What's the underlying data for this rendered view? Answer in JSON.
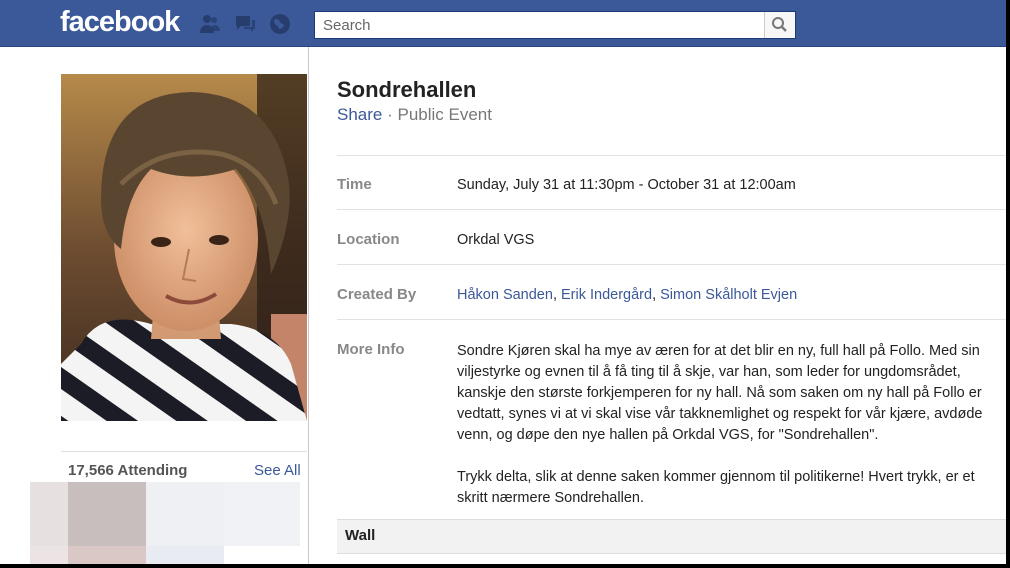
{
  "header": {
    "logo": "facebook",
    "search_placeholder": "Search",
    "colors": {
      "bar": "#3b5998",
      "link": "#3b5998"
    },
    "icons": [
      "friend-requests-icon",
      "messages-icon",
      "notifications-icon",
      "magnifier-icon"
    ]
  },
  "sidebar": {
    "attending": "17,566 Attending",
    "see_all": "See All"
  },
  "event": {
    "title": "Sondrehallen",
    "share": "Share",
    "separator": " · ",
    "type": "Public Event",
    "time_label": "Time",
    "time_value": "Sunday, July 31 at 11:30pm - October 31 at 12:00am",
    "location_label": "Location",
    "location_value": "Orkdal VGS",
    "created_label": "Created By",
    "creators": [
      "Håkon Sanden",
      "Erik Indergård",
      "Simon Skålholt Evjen"
    ],
    "creator_sep": ", ",
    "info_label": "More Info",
    "info_p1": "Sondre Kjøren skal ha mye av æren for at det blir en ny, full hall på Follo. Med sin viljestyrke og evnen til å få ting til å skje, var han, som leder for ungdomsrådet, kanskje den største forkjemperen for ny hall. Nå som saken om ny hall på Follo er vedtatt, synes vi at vi skal vise vår takknemlighet og respekt for vår kjære, avdøde venn, og døpe den nye hallen på Orkdal VGS, for \"Sondrehallen\".",
    "info_p2": "Trykk delta, slik at denne saken kommer gjennom til politikerne! Hvert trykk, er et skritt nærmere Sondrehallen.",
    "wall_label": "Wall"
  }
}
